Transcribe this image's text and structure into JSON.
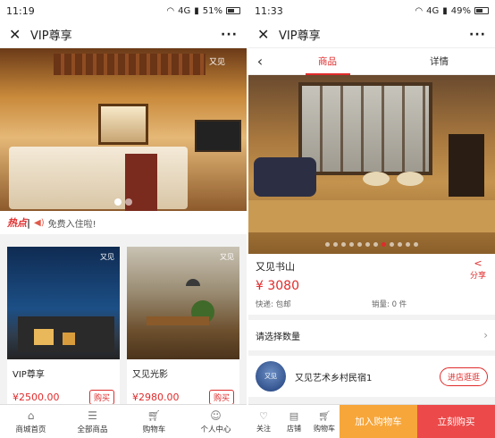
{
  "left": {
    "status": {
      "time": "11:19",
      "network": "4G",
      "battery": "51%"
    },
    "title": "VIP尊享",
    "hero": {
      "logo": "又见"
    },
    "hot": {
      "label": "热点",
      "message": "免费入住啦!"
    },
    "products": [
      {
        "name": "VIP尊享",
        "price": "¥2500.00",
        "buy": "购买",
        "logo": "又见"
      },
      {
        "name": "又见光影",
        "price": "¥2980.00",
        "buy": "购买",
        "logo": "又见"
      }
    ],
    "tabs": [
      {
        "label": "商城首页",
        "icon": "home-icon"
      },
      {
        "label": "全部商品",
        "icon": "list-icon"
      },
      {
        "label": "购物车",
        "icon": "cart-icon"
      },
      {
        "label": "个人中心",
        "icon": "user-icon"
      }
    ]
  },
  "right": {
    "status": {
      "time": "11:33",
      "network": "4G",
      "battery": "49%"
    },
    "title": "VIP尊享",
    "segments": [
      "商品",
      "详情"
    ],
    "product": {
      "name": "又见书山",
      "price": "¥ 3080",
      "shipping": "快递: 包邮",
      "sales": "销量: 0 件",
      "share": "分享"
    },
    "qty_label": "请选择数量",
    "shop": {
      "name": "又见艺术乡村民宿1",
      "avatar_text": "又见",
      "enter": "进店逛逛"
    },
    "bottom": {
      "follow": "关注",
      "store": "店铺",
      "cart": "购物车",
      "add_cart": "加入购物车",
      "buy_now": "立刻购买"
    }
  }
}
